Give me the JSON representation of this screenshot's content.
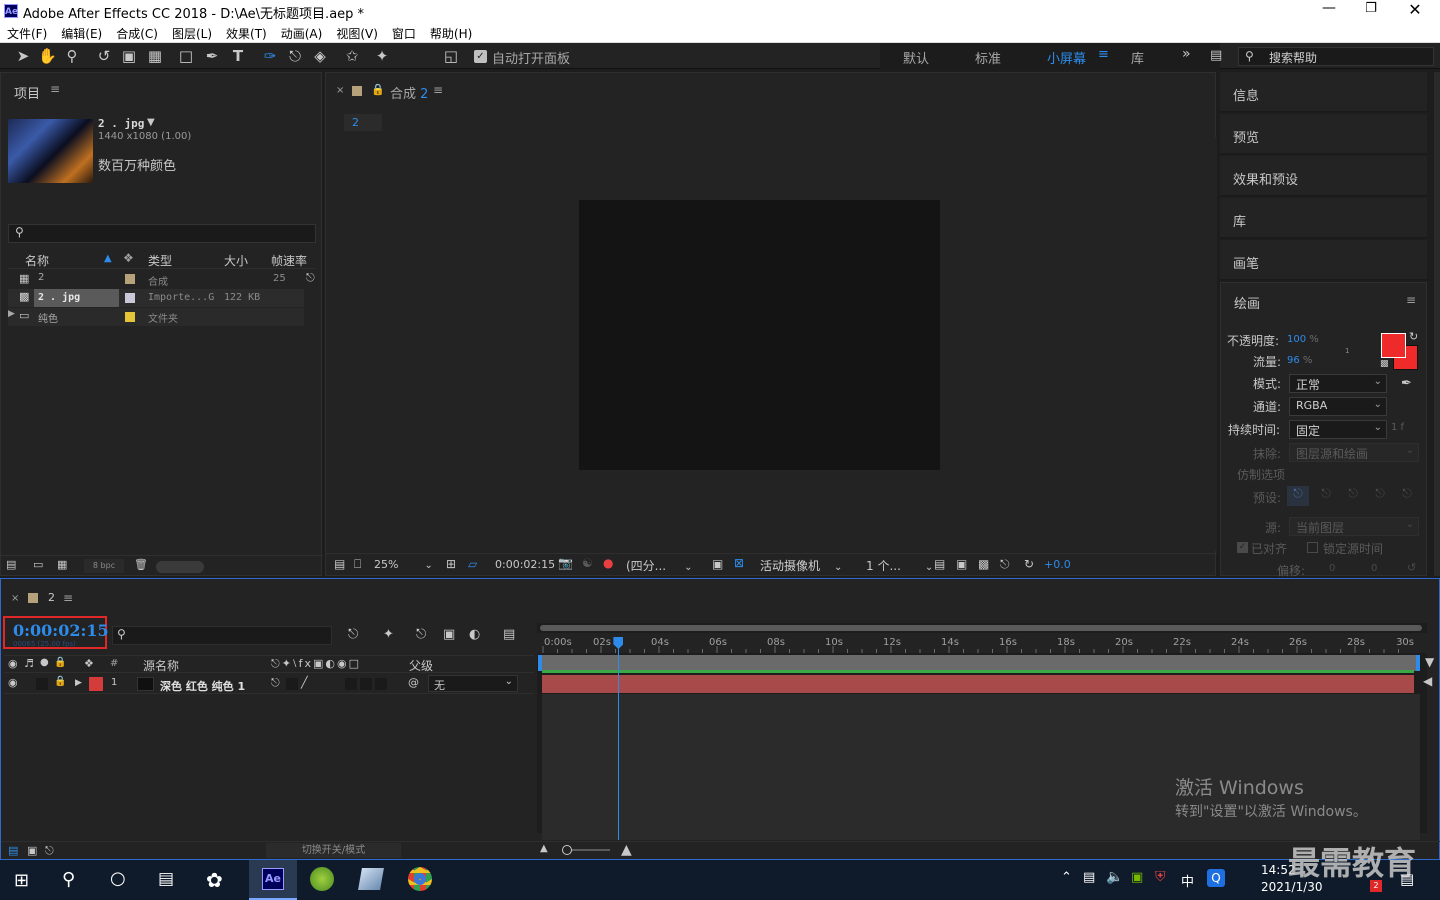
{
  "window": {
    "title": "Adobe After Effects CC 2018 - D:\\Ae\\无标题项目.aep *",
    "logo": "Ae"
  },
  "menu": [
    "文件(F)",
    "编辑(E)",
    "合成(C)",
    "图层(L)",
    "效果(T)",
    "动画(A)",
    "视图(V)",
    "窗口",
    "帮助(H)"
  ],
  "toolbar": {
    "auto_open": "自动打开面板",
    "workspaces": [
      "默认",
      "标准",
      "小屏幕",
      "库"
    ],
    "active_workspace": "小屏幕",
    "search_placeholder": "搜索帮助"
  },
  "project": {
    "title": "项目",
    "file_name": "2 . jpg",
    "file_dims": "1440 x1080 (1.00)",
    "file_colors": "数百万种颜色",
    "columns": [
      "名称",
      "类型",
      "大小",
      "帧速率"
    ],
    "rows": [
      {
        "name": "2",
        "type": "合成",
        "size": "",
        "fps": "25",
        "color": "#b6a27a"
      },
      {
        "name": "2 . jpg",
        "type": "Importe...G",
        "size": "122 KB",
        "fps": "",
        "color": "#c8c8d8"
      },
      {
        "name": "纯色",
        "type": "文件夹",
        "size": "",
        "fps": "",
        "color": "#e6c43a"
      }
    ],
    "bpc": "8 bpc"
  },
  "composition": {
    "tab_label": "合成",
    "tab_number": "2",
    "breadcrumb": "2",
    "zoom": "25%",
    "timecode": "0:00:02:15",
    "resolution": "(四分...",
    "camera": "活动摄像机",
    "views": "1 个...",
    "exposure": "+0.0"
  },
  "right_panels": [
    "信息",
    "预览",
    "效果和预设",
    "库",
    "画笔"
  ],
  "paint": {
    "title": "绘画",
    "opacity_label": "不透明度:",
    "opacity_value": "100",
    "flow_label": "流量:",
    "flow_value": "96",
    "percent": "%",
    "mode_label": "模式:",
    "mode_value": "正常",
    "channel_label": "通道:",
    "channel_value": "RGBA",
    "duration_label": "持续时间:",
    "duration_value": "固定",
    "duration_frames": "1 f",
    "erase_label": "抹除:",
    "erase_value": "图层源和绘画",
    "clone_label": "仿制选项",
    "preset_label": "预设:",
    "source_label": "源:",
    "source_value": "当前图层",
    "aligned": "已对齐",
    "lock_source": "锁定源时间",
    "offset_label": "偏移:",
    "offset_x": "0",
    "offset_y": "0",
    "small_one": "1",
    "fg_color": "#ee2a2a",
    "bg_color": "#ee2a2a"
  },
  "timeline": {
    "tab_number": "2",
    "timecode": "0:00:02:15",
    "frame_info": "00065 (25.00 fps)",
    "col_source": "源名称",
    "col_parent": "父级",
    "col_hash": "#",
    "ruler": [
      "0:00s",
      "02s",
      "04s",
      "06s",
      "08s",
      "10s",
      "12s",
      "14s",
      "16s",
      "18s",
      "20s",
      "22s",
      "24s",
      "26s",
      "28s",
      "30s"
    ],
    "playhead_seconds": 2.6,
    "duration_seconds": 30,
    "layers": [
      {
        "num": "1",
        "name": "深色 红色 纯色 1",
        "parent": "无",
        "color": "#d43b3b"
      }
    ],
    "toggle_label": "切换开关/模式"
  },
  "watermark": {
    "line1": "激活 Windows",
    "line2": "转到\"设置\"以激活 Windows。"
  },
  "taskbar": {
    "time": "14:52",
    "date": "2021/1/30",
    "ime": "中",
    "brand": "最需教育",
    "ae_label": "Ae",
    "notif": "2"
  }
}
